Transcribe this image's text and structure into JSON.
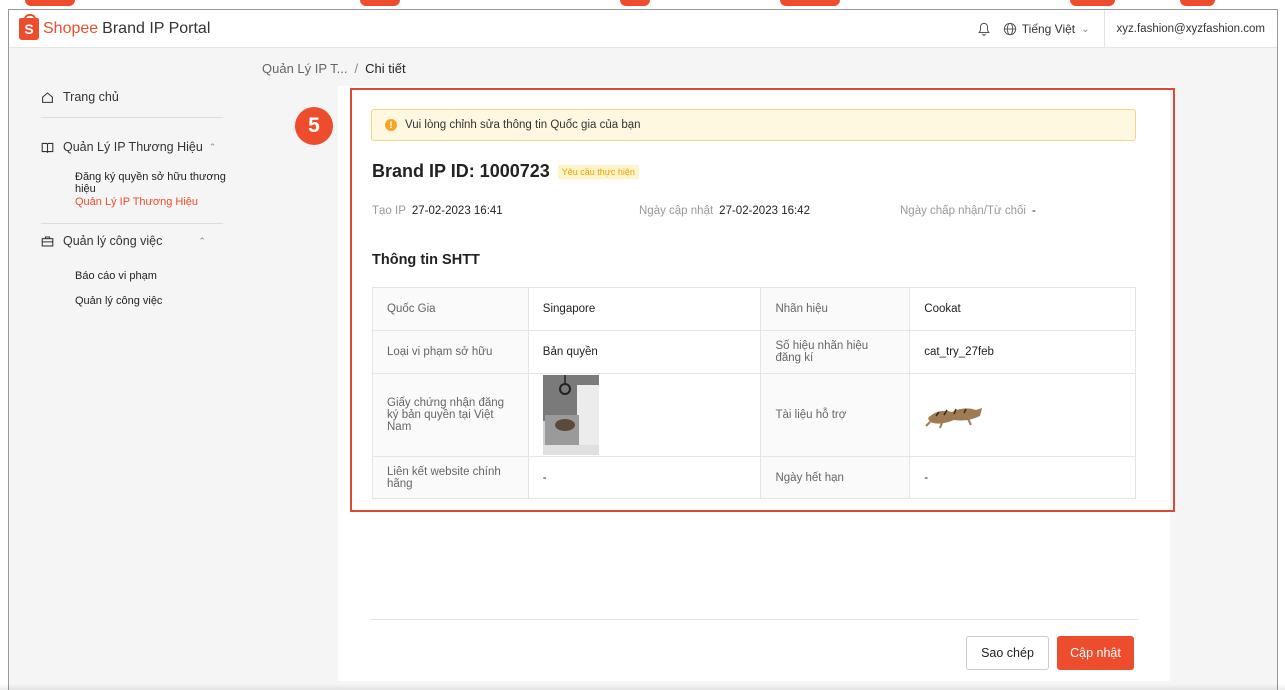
{
  "header": {
    "logo_shopee": "Shopee",
    "logo_portal": "Brand IP Portal",
    "language": "Tiếng Việt",
    "email": "xyz.fashion@xyzfashion.com"
  },
  "sidebar": {
    "home": "Trang chủ",
    "groups": [
      {
        "label": "Quản Lý IP Thương Hiệu",
        "items": [
          "Đăng ký quyền sở hữu thương hiệu",
          "Quản Lý IP Thương Hiệu"
        ]
      },
      {
        "label": "Quản lý công việc",
        "items": [
          "Báo cáo vi phạm",
          "Quản lý công việc"
        ]
      }
    ]
  },
  "breadcrumb": {
    "parent": "Quản Lý IP T...",
    "separator": "/",
    "current": "Chi tiết"
  },
  "step_badge": "5",
  "alert": "Vui lòng chỉnh sửa thông tin Quốc gia của bạn",
  "brand": {
    "title": "Brand IP ID: 1000723",
    "status": "Yêu cầu thực hiện"
  },
  "meta": {
    "created_label": "Tạo IP",
    "created_value": "27-02-2023 16:41",
    "updated_label": "Ngày cập nhật",
    "updated_value": "27-02-2023 16:42",
    "decision_label": "Ngày chấp nhận/Từ chối",
    "decision_value": "-"
  },
  "section_title": "Thông tin SHTT",
  "table": {
    "country_label": "Quốc Gia",
    "country_value": "Singapore",
    "trademark_label": "Nhãn hiệu",
    "trademark_value": "Cookat",
    "violation_label": "Loại vi phạm sở hữu",
    "violation_value": "Bản quyền",
    "regno_label": "Số hiệu nhãn hiệu đăng kí",
    "regno_value": "cat_try_27feb",
    "certificate_label": "Giấy chứng nhận đăng ký bản quyền tại Việt Nam",
    "support_label": "Tài liệu hỗ trợ",
    "website_label": "Liên kết website chính hãng",
    "website_value": "-",
    "expiry_label": "Ngày hết hạn",
    "expiry_value": "-"
  },
  "buttons": {
    "copy": "Sao chép",
    "update": "Cập nhật"
  },
  "colors": {
    "brand": "#ee4d2d",
    "highlight": "#d94a3a",
    "alert_bg": "#fff8e1",
    "status_text": "#e8a200"
  }
}
